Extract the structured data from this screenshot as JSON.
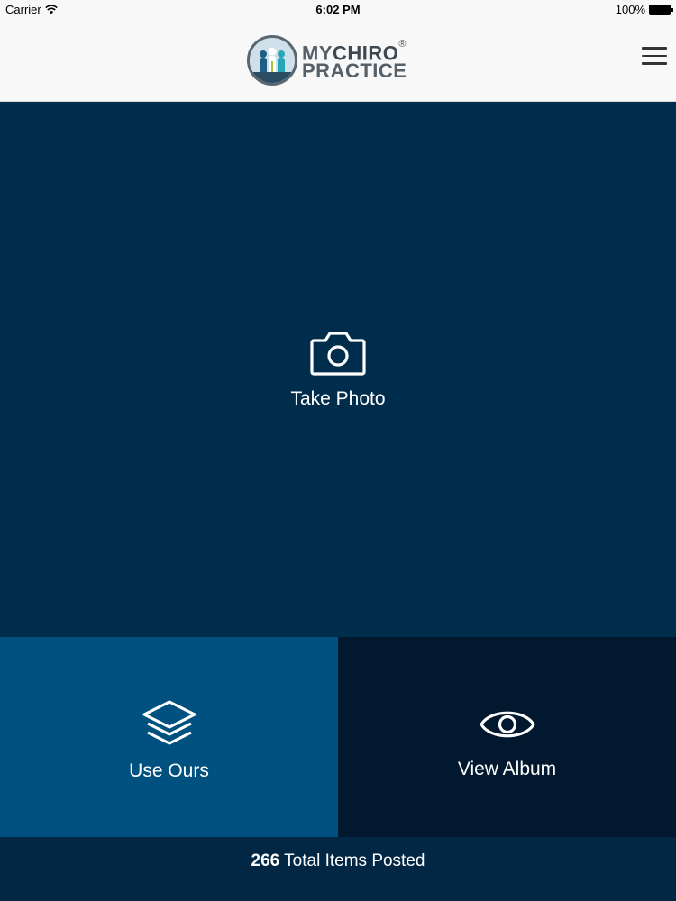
{
  "status_bar": {
    "carrier": "Carrier",
    "time": "6:02 PM",
    "battery": "100%"
  },
  "header": {
    "logo": {
      "line1_my": "MY",
      "line1_chiro": "CHIRO",
      "registered": "®",
      "line2": "PRACTICE"
    },
    "menu_icon": "hamburger-menu-icon"
  },
  "tiles": {
    "take_photo": {
      "label": "Take Photo",
      "icon": "camera-icon"
    },
    "use_ours": {
      "label": "Use Ours",
      "icon": "layers-icon"
    },
    "view_album": {
      "label": "View Album",
      "icon": "eye-icon"
    }
  },
  "footer": {
    "count": "266",
    "text": "Total Items Posted"
  },
  "colors": {
    "main_tile": "#012d4d",
    "use_ours_tile": "#005180",
    "view_album_tile": "#01182f",
    "footer": "#012745",
    "header_bg": "#f8f8f8"
  }
}
